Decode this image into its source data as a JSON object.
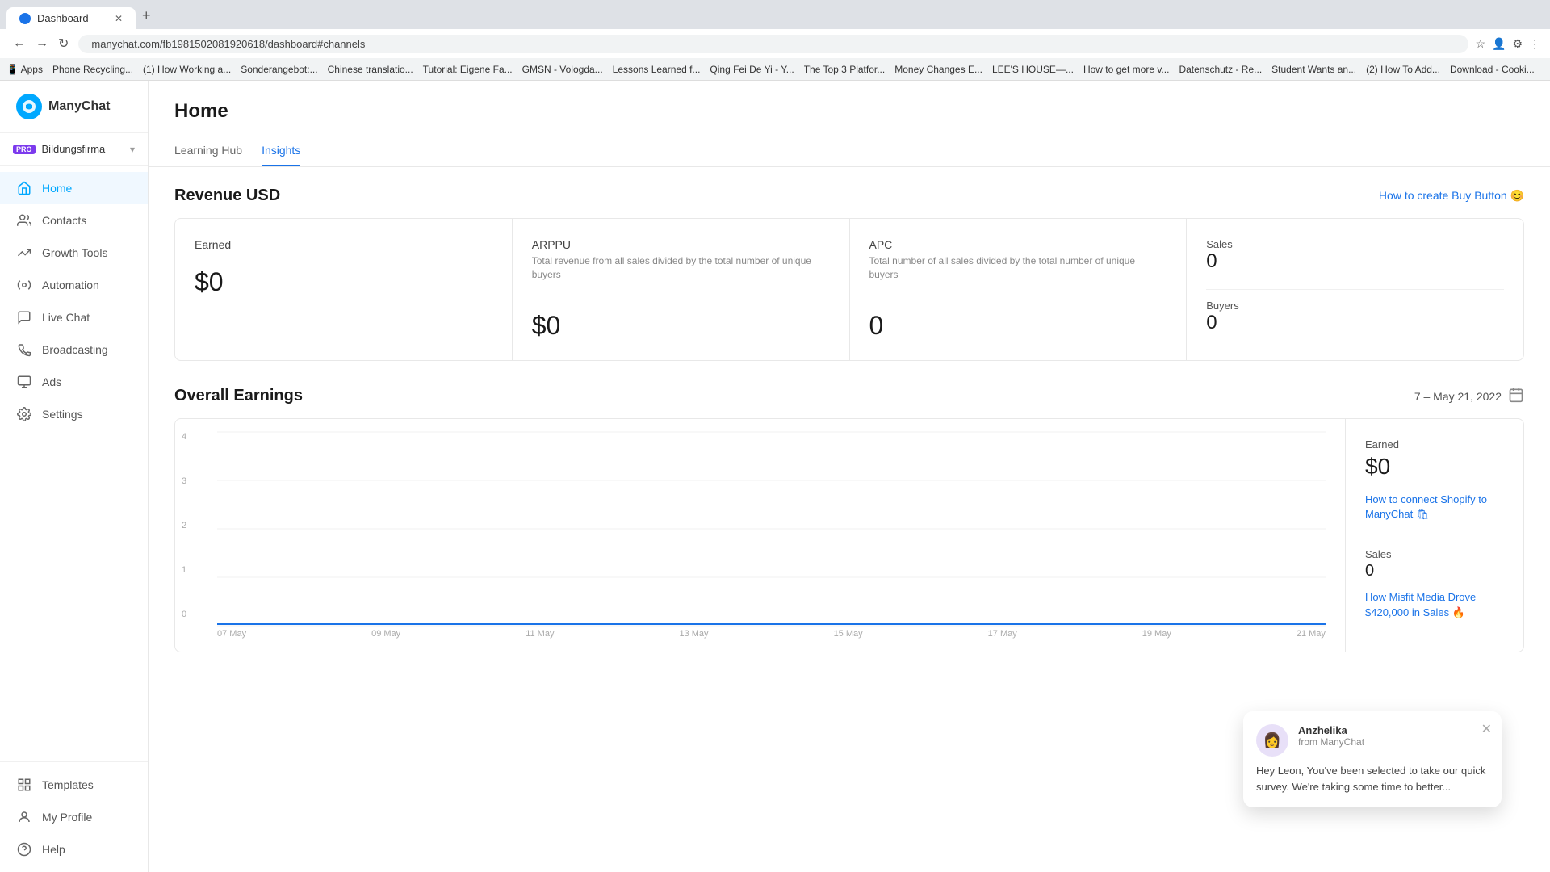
{
  "browser": {
    "tab_title": "Dashboard",
    "url": "manychat.com/fb1981502081920618/dashboard#channels",
    "bookmarks": [
      "Apps",
      "Phone Recycling...",
      "(1) How Working a...",
      "Sonderangebot:...",
      "Chinese translatio...",
      "Tutorial: Eigene Fa...",
      "GMSN - Vologda...",
      "Lessons Learned f...",
      "Qing Fei De Yi - Y...",
      "The Top 3 Platfor...",
      "Money Changes E...",
      "LEE'S HOUSE—...",
      "How to get more v...",
      "Datenschutz - Re...",
      "Student Wants an...",
      "(2) How To Add...",
      "Download - Cooki..."
    ]
  },
  "sidebar": {
    "logo_text": "ManyChat",
    "account_badge": "PRO",
    "account_name": "Bildungsfirma",
    "nav_items": [
      {
        "label": "Home",
        "active": true
      },
      {
        "label": "Contacts",
        "active": false
      },
      {
        "label": "Growth Tools",
        "active": false
      },
      {
        "label": "Automation",
        "active": false
      },
      {
        "label": "Live Chat",
        "active": false
      },
      {
        "label": "Broadcasting",
        "active": false
      },
      {
        "label": "Ads",
        "active": false
      },
      {
        "label": "Settings",
        "active": false
      }
    ],
    "bottom_items": [
      {
        "label": "Templates"
      },
      {
        "label": "My Profile"
      },
      {
        "label": "Help"
      }
    ]
  },
  "page": {
    "title": "Home",
    "tabs": [
      {
        "label": "Learning Hub",
        "active": false
      },
      {
        "label": "Insights",
        "active": true
      }
    ]
  },
  "revenue": {
    "section_title": "Revenue USD",
    "link_text": "How to create Buy Button 😊",
    "cards": [
      {
        "label": "Earned",
        "desc": "",
        "value": "$0"
      },
      {
        "label": "ARPPU",
        "desc": "Total revenue from all sales divided by the total number of unique buyers",
        "value": "$0"
      },
      {
        "label": "APC",
        "desc": "Total number of all sales divided by the total number of unique buyers",
        "value": "0"
      }
    ],
    "right_card": {
      "sales_label": "Sales",
      "sales_value": "0",
      "buyers_label": "Buyers",
      "buyers_value": "0"
    }
  },
  "earnings": {
    "section_title": "Overall Earnings",
    "date_range": "7 – May 21, 2022",
    "chart": {
      "y_labels": [
        "4",
        "3",
        "2",
        "1",
        "0"
      ],
      "x_labels": [
        "07 May",
        "09 May",
        "11 May",
        "13 May",
        "15 May",
        "17 May",
        "19 May",
        "21 May"
      ]
    },
    "sidebar": {
      "earned_label": "Earned",
      "earned_value": "$0",
      "link1": "How to connect Shopify to ManyChat 🛍",
      "sales_label": "Sales",
      "sales_value": "0",
      "link2": "How Misfit Media Drove $420,000 in Sales 🔥"
    }
  },
  "chat_popup": {
    "agent_name": "Anzhelika",
    "company": "from ManyChat",
    "message": "Hey Leon,  You've been selected to take our quick survey. We're taking some time to better..."
  }
}
